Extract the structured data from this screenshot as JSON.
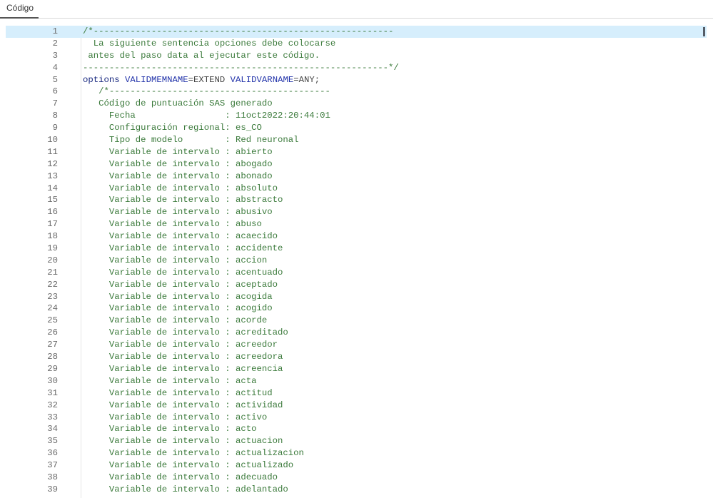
{
  "tab": {
    "label": "Código"
  },
  "header_lines": [
    [
      {
        "t": "/*---------------------------------------------------------",
        "k": "c"
      }
    ],
    [
      {
        "t": "  La siguiente sentencia opciones debe colocarse",
        "k": "c"
      }
    ],
    [
      {
        "t": " antes del paso data al ejecutar este código.",
        "k": "c"
      }
    ],
    [
      {
        "t": "----------------------------------------------------------*/",
        "k": "c"
      }
    ],
    [
      {
        "t": "options",
        "k": "kw"
      },
      {
        "t": " ",
        "k": "plain"
      },
      {
        "t": "VALIDMEMNAME",
        "k": "opt"
      },
      {
        "t": "=EXTEND ",
        "k": "plain"
      },
      {
        "t": "VALIDVARNAME",
        "k": "opt"
      },
      {
        "t": "=ANY;",
        "k": "plain"
      }
    ],
    [
      {
        "t": "   /*------------------------------------------",
        "k": "c"
      }
    ],
    [
      {
        "t": "   Código de puntuación SAS generado",
        "k": "c"
      }
    ],
    [
      {
        "t": "     Fecha                 : 11oct2022:20:44:01",
        "k": "c"
      }
    ],
    [
      {
        "t": "     Configuración regional: es_CO",
        "k": "c"
      }
    ],
    [
      {
        "t": "     Tipo de modelo        : Red neuronal",
        "k": "c"
      }
    ]
  ],
  "interval_prefix": "     Variable de intervalo : ",
  "interval_variables": [
    "abierto",
    "abogado",
    "abonado",
    "absoluto",
    "abstracto",
    "abusivo",
    "abuso",
    "acaecido",
    "accidente",
    "accion",
    "acentuado",
    "aceptado",
    "acogida",
    "acogido",
    "acorde",
    "acreditado",
    "acreedor",
    "acreedora",
    "acreencia",
    "acta",
    "actitud",
    "actividad",
    "activo",
    "acto",
    "actuacion",
    "actualizacion",
    "actualizado",
    "adecuado",
    "adelantado"
  ],
  "active_line": 1
}
